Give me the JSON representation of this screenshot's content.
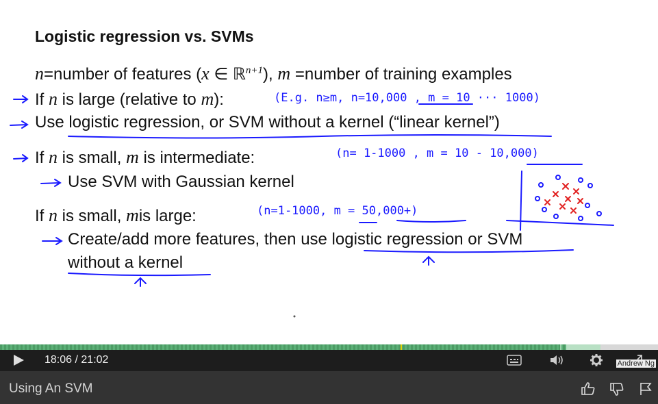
{
  "slide": {
    "title": "Logistic regression vs. SVMs",
    "line1": {
      "n": "n",
      "eq1": "=number of features (",
      "x": "x",
      "in": " ∈ ℝ",
      "sup": "n+1",
      "mid": "),  ",
      "m": "m",
      "eq2": " =number of training examples"
    },
    "line2": {
      "pre": "If ",
      "n": "n",
      "mid": " is large (relative to ",
      "m": "m",
      "post": "):"
    },
    "line3": {
      "text": "Use logistic regression, or SVM without a kernel (“linear kernel”)"
    },
    "line4": {
      "pre": "If ",
      "n": "n",
      "mid": " is small, ",
      "m": "m",
      "post": " is intermediate:"
    },
    "line5": {
      "text": "Use SVM with Gaussian kernel"
    },
    "line6": {
      "pre": "If ",
      "n": "n",
      "mid": " is small, ",
      "m": "m",
      "post": "is large:"
    },
    "line7": {
      "text": "Create/add more features, then use logistic regression or SVM"
    },
    "line8": {
      "text": "without a kernel"
    },
    "handwriting": {
      "note1": "(E.g.  n≥m,    n=10,000   ,  m = 10 ··· 1000)",
      "note2": "(n= 1-1000 ,  m = 10 - 10,000)",
      "note3": "(n=1-1000,   m = 50,000+)"
    },
    "credit": "Andrew Ng"
  },
  "player": {
    "current_time": "18:06",
    "separator": " / ",
    "duration": "21:02",
    "progress": 0.8605,
    "buffered": 0.9126,
    "play_icon": "play-icon",
    "captions_icon": "captions-icon",
    "volume_icon": "volume-icon",
    "settings_icon": "gear-icon",
    "fullscreen_icon": "fullscreen-icon"
  },
  "footer": {
    "lecture_title": "Using An SVM",
    "like_icon": "thumbs-up-icon",
    "dislike_icon": "thumbs-down-icon",
    "flag_icon": "flag-icon"
  },
  "colors": {
    "ink": "#1a1aff",
    "red_ink": "#e22222",
    "progress": "#4c9b64",
    "controls_bg": "#1d1d1d",
    "footer_bg": "#333333"
  }
}
